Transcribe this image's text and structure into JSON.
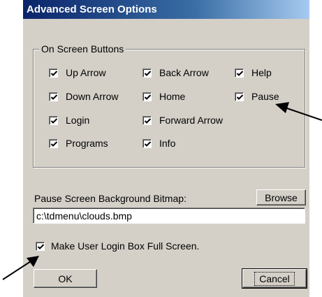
{
  "dialog": {
    "title": "Advanced Screen Options"
  },
  "on_screen_buttons": {
    "legend": "On Screen Buttons",
    "items": [
      {
        "label": "Up Arrow",
        "checked": true
      },
      {
        "label": "Back Arrow",
        "checked": true
      },
      {
        "label": "Help",
        "checked": true
      },
      {
        "label": "Down Arrow",
        "checked": true
      },
      {
        "label": "Home",
        "checked": true
      },
      {
        "label": "Pause",
        "checked": true
      },
      {
        "label": "Login",
        "checked": true
      },
      {
        "label": "Forward Arrow",
        "checked": true
      },
      {
        "label": "Programs",
        "checked": true
      },
      {
        "label": "Info",
        "checked": true
      }
    ]
  },
  "pause_background": {
    "label": "Pause Screen Background Bitmap:",
    "browse_label": "Browse",
    "path_value": "c:\\tdmenu\\clouds.bmp"
  },
  "login_fullscreen": {
    "label": "Make User Login Box Full Screen.",
    "checked": true
  },
  "buttons": {
    "ok_label": "OK",
    "cancel_label": "Cancel"
  }
}
